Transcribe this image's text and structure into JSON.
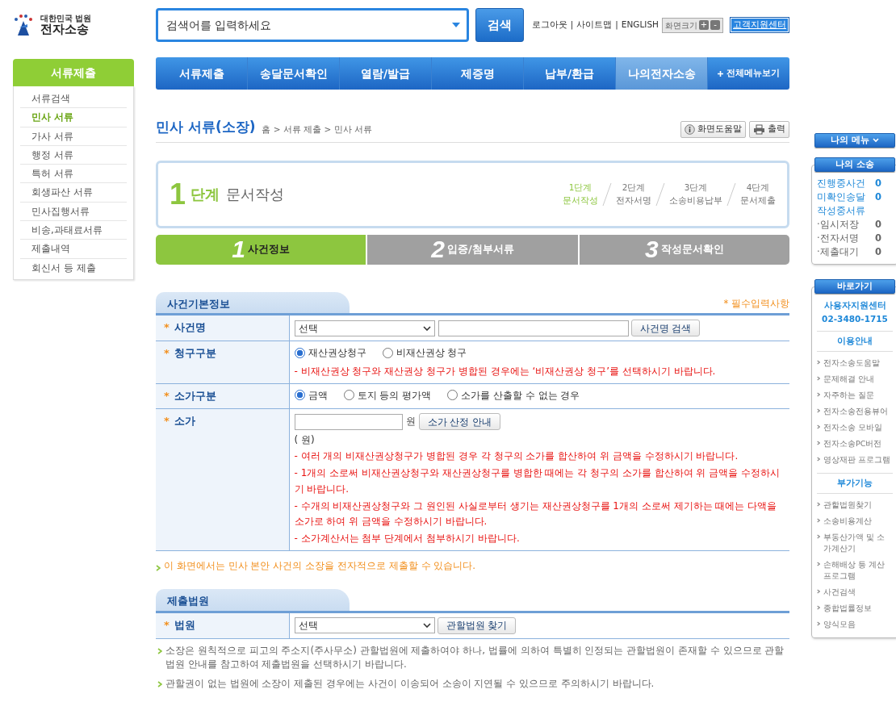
{
  "logo": {
    "line1": "대한민국 법원",
    "line2": "전자소송"
  },
  "search": {
    "placeholder": "검색어를 입력하세요",
    "button": "검색"
  },
  "top_links": [
    "로그아웃",
    "사이트맵",
    "ENGLISH"
  ],
  "top_link_separator": "|",
  "zoom": {
    "label": "화면크기",
    "plus": "+",
    "minus": "-"
  },
  "customer_center": "고객지원센터",
  "nav": {
    "items": [
      {
        "label": "서류제출",
        "selected": false
      },
      {
        "label": "송달문서확인",
        "selected": false
      },
      {
        "label": "열람/발급",
        "selected": false
      },
      {
        "label": "제증명",
        "selected": false
      },
      {
        "label": "납부/환급",
        "selected": false
      },
      {
        "label": "나의전자소송",
        "selected": true
      }
    ],
    "all_menu": "전체메뉴보기"
  },
  "sidebar": {
    "title": "서류제출",
    "items": [
      {
        "label": "서류검색",
        "selected": false
      },
      {
        "label": "민사 서류",
        "selected": true
      },
      {
        "label": "가사 서류",
        "selected": false
      },
      {
        "label": "행정 서류",
        "selected": false
      },
      {
        "label": "특허 서류",
        "selected": false
      },
      {
        "label": "회생파산 서류",
        "selected": false
      },
      {
        "label": "민사집행서류",
        "selected": false
      },
      {
        "label": "비송,과태료서류",
        "selected": false
      },
      {
        "label": "제출내역",
        "selected": false
      },
      {
        "label": "회신서 등 제출",
        "selected": false
      }
    ]
  },
  "page": {
    "title": "민사 서류(소장)",
    "breadcrumb": "홈 > 서류 제출 > 민사 서류",
    "help_button": "화면도움말",
    "print_button": "출력"
  },
  "step_banner": {
    "number": "1",
    "unit": "단계",
    "title": "문서작성",
    "steps": [
      {
        "label": "1단계",
        "sub": "문서작성",
        "selected": true
      },
      {
        "label": "2단계",
        "sub": "전자서명",
        "selected": false
      },
      {
        "label": "3단계",
        "sub": "소송비용납부",
        "selected": false
      },
      {
        "label": "4단계",
        "sub": "문서제출",
        "selected": false
      }
    ]
  },
  "tabs": [
    {
      "number": "1",
      "label": "사건정보",
      "selected": true
    },
    {
      "number": "2",
      "label": "입증/첨부서류",
      "selected": false
    },
    {
      "number": "3",
      "label": "작성문서확인",
      "selected": false
    }
  ],
  "case_info": {
    "title": "사건기본정보",
    "required_note": "* 필수입력사항",
    "rows": [
      {
        "kind": "select_search",
        "mark": "*",
        "label": "사건명",
        "select": "선택",
        "button": "사건명 검색"
      },
      {
        "kind": "radios",
        "mark": "*",
        "label": "청구구분",
        "options": [
          {
            "label": "재산권상청구",
            "selected": true
          },
          {
            "label": "비재산권상 청구",
            "selected": false
          }
        ],
        "notes": [
          "- 비재산권상 청구와 재산권상 청구가 병합된 경우에는 ‘비재산권상 청구’를 선택하시기 바랍니다."
        ]
      },
      {
        "kind": "radios",
        "mark": "*",
        "label": "소가구분",
        "options": [
          {
            "label": "금액",
            "selected": true
          },
          {
            "label": "토지 등의 평가액",
            "selected": false
          },
          {
            "label": "소가를 산출할 수 없는 경우",
            "selected": false
          }
        ]
      },
      {
        "kind": "amount",
        "mark": "*",
        "label": "소가",
        "unit": "원",
        "button": "소가 산정 안내",
        "hint": "( 원)",
        "notes": [
          "- 여러 개의 비재산권상청구가 병합된 경우 각 청구의 소가를 합산하여 위 금액을 수정하시기 바랍니다.",
          "- 1개의 소로써 비재산권상청구와 재산권상청구를 병합한 때에는 각 청구의 소가를 합산하여 위 금액을 수정하시기 바랍니다.",
          "- 수개의 비재산권상청구와 그 원인된 사실로부터 생기는 재산권상청구를 1개의 소로써 제기하는 때에는 다액을 소가로 하여 위 금액을 수정하시기 바랍니다.",
          "- 소가계산서는 첨부 단계에서 첨부하시기 바랍니다."
        ]
      }
    ]
  },
  "intro_note": "이 화면에서는 민사 본안 사건의 소장을 전자적으로 제출할 수 있습니다.",
  "court": {
    "title": "제출법원",
    "rows": [
      {
        "kind": "select_search",
        "mark": "*",
        "label": "법원",
        "select": "선택",
        "button": "관할법원 찾기"
      }
    ],
    "notes": [
      "소장은 원칙적으로 피고의 주소지(주사무소) 관할법원에 제출하여야 하나, 법률에 의하여 특별히 인정되는 관할법원이 존재할 수 있으므로 관할법원 안내를 참고하여 제출법원을 선택하시기 바랍니다.",
      "관할권이 없는 법원에 소장이 제출된 경우에는 사건이 이송되어 소송이 지연될 수 있으므로 주의하시기 바랍니다."
    ]
  },
  "my_menu": "나의 메뉴",
  "my_case": {
    "title": "나의 소송",
    "items": [
      {
        "kind": "main",
        "label": "진행중사건",
        "count": "0"
      },
      {
        "kind": "main",
        "label": "미확인송달",
        "count": "0"
      },
      {
        "kind": "main",
        "label": "작성중서류"
      },
      {
        "kind": "sub",
        "label": "·임시저장",
        "count": "0"
      },
      {
        "kind": "sub",
        "label": "·전자서명",
        "count": "0"
      },
      {
        "kind": "sub",
        "label": "·제출대기",
        "count": "0"
      }
    ]
  },
  "shortcuts": {
    "title": "바로가기",
    "support_label": "사용자지원센터",
    "support_phone": "02-3480-1715",
    "groups": [
      {
        "title": "이용안내",
        "links": [
          "전자소송도움말",
          "문제해결 안내",
          "자주하는 질문",
          "전자소송전용뷰어",
          "전자소송 모바일",
          "전자소송PC버전",
          "영상재판 프로그램"
        ]
      },
      {
        "title": "부가기능",
        "links": [
          "관할법원찾기",
          "소송비용계산",
          "부동산가액 및 소가계산기",
          "손해배상 등 계산 프로그램",
          "사건검색",
          "종합법률정보",
          "양식모음"
        ]
      }
    ]
  }
}
